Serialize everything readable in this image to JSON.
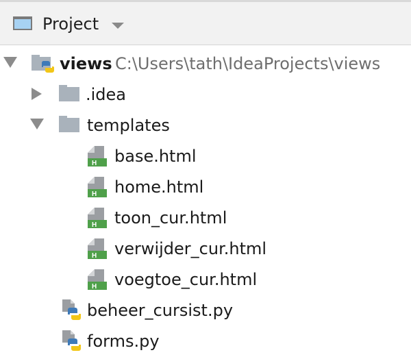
{
  "header": {
    "title": "Project",
    "icon": "project-window-icon",
    "dropdown_icon": "chevron-down-icon"
  },
  "colors": {
    "folder": "#a9b2bb",
    "html_badge": "#4fa04a",
    "python_blue": "#3e7ab8",
    "python_yellow": "#f2c618"
  },
  "tree": {
    "root": {
      "name": "views",
      "path": "C:\\Users\\tath\\IdeaProjects\\views",
      "expanded": true,
      "icon": "python-folder-icon"
    },
    "idea_folder": {
      "name": ".idea",
      "expanded": false,
      "icon": "folder-icon"
    },
    "templates_folder": {
      "name": "templates",
      "expanded": true,
      "icon": "folder-icon"
    },
    "template_files": [
      {
        "name": "base.html",
        "icon": "html-file-icon"
      },
      {
        "name": "home.html",
        "icon": "html-file-icon"
      },
      {
        "name": "toon_cur.html",
        "icon": "html-file-icon"
      },
      {
        "name": "verwijder_cur.html",
        "icon": "html-file-icon"
      },
      {
        "name": "voegtoe_cur.html",
        "icon": "html-file-icon"
      }
    ],
    "py_files": [
      {
        "name": "beheer_cursist.py",
        "icon": "python-file-icon"
      },
      {
        "name": "forms.py",
        "icon": "python-file-icon"
      }
    ]
  }
}
